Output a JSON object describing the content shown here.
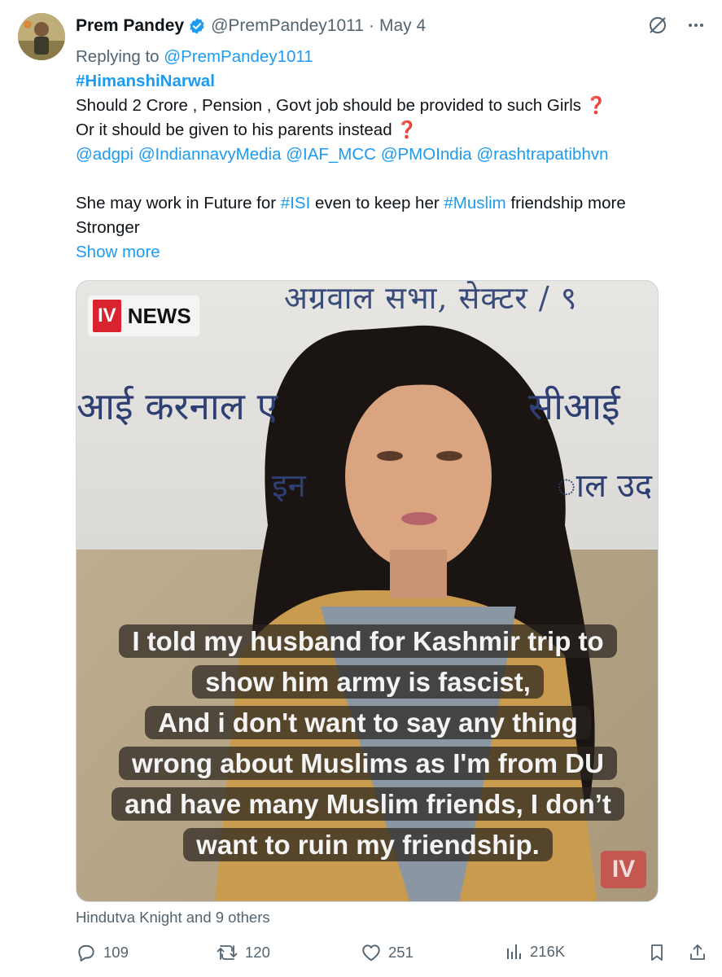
{
  "tweet": {
    "author_name": "Prem Pandey",
    "handle": "@PremPandey1011",
    "separator": "·",
    "date": "May 4",
    "replying_prefix": "Replying to",
    "replying_to": "@PremPandey1011",
    "hashtag_line": "#HimanshiNarwal",
    "line1": "Should 2 Crore  , Pension , Govt job should be provided to such Girls",
    "line2": "Or it should be given to his  parents instead",
    "question_mark": "❓",
    "mentions": [
      "@adgpi",
      "@IndiannavyMedia",
      "@IAF_MCC",
      "@PMOIndia",
      "@rashtrapatibhvn"
    ],
    "line3_a": "She may work in Future for",
    "line3_tag1": "#ISI",
    "line3_b": "even to keep her",
    "line3_tag2": "#Muslim",
    "line3_c": "friendship more",
    "line4": "Stronger",
    "show_more": "Show more"
  },
  "media": {
    "logo_iv": "IV",
    "logo_news": "NEWS",
    "banner_top": "अग्रवाल सभा, सेक्टर / ९",
    "banner_mid_left": "आई करनाल ए",
    "banner_mid_right": "सीआई",
    "banner_low_left": "इन",
    "banner_low_right": "ाल उद",
    "caption_lines": [
      "I told my husband for Kashmir trip to",
      "show him army is fascist,",
      "And i don't want to say any thing",
      "wrong about Muslims as I'm from DU",
      "and have many Muslim friends, I don’t",
      "want to ruin my friendship."
    ],
    "watermark": "IV"
  },
  "liked_by": "Hindutva Knight and 9 others",
  "actions": {
    "replies": "109",
    "reposts": "120",
    "likes": "251",
    "views": "216K"
  },
  "colors": {
    "accent": "#1d9bf0",
    "muted": "#536471",
    "text": "#0f1419"
  }
}
